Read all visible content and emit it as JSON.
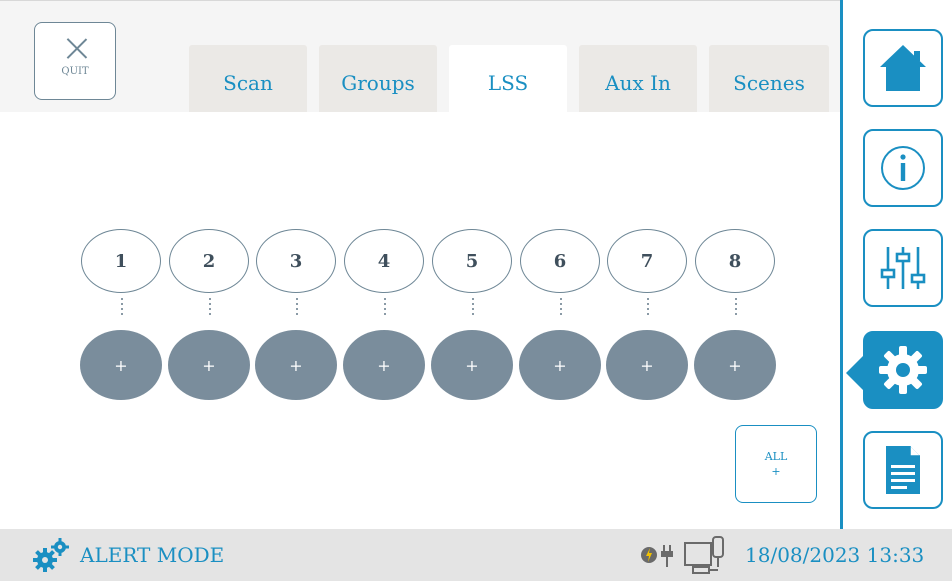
{
  "quit": {
    "label": "QUIT"
  },
  "tabs": [
    "Scan",
    "Groups",
    "LSS",
    "Aux In",
    "Scenes"
  ],
  "active_tab": "LSS",
  "channels": [
    "1",
    "2",
    "3",
    "4",
    "5",
    "6",
    "7",
    "8"
  ],
  "add_symbol": "+",
  "all_button": {
    "line1": "ALL",
    "line2": "+"
  },
  "sidebar": {
    "items": [
      "home-icon",
      "info-icon",
      "sliders-icon",
      "gear-icon",
      "document-icon"
    ],
    "active": "gear-icon"
  },
  "status": {
    "mode": "ALERT MODE",
    "datetime": "18/08/2023 13:33"
  },
  "colors": {
    "accent": "#1a8fc2",
    "circle_fill": "#7a8d9c",
    "circle_border": "#6e8796"
  }
}
